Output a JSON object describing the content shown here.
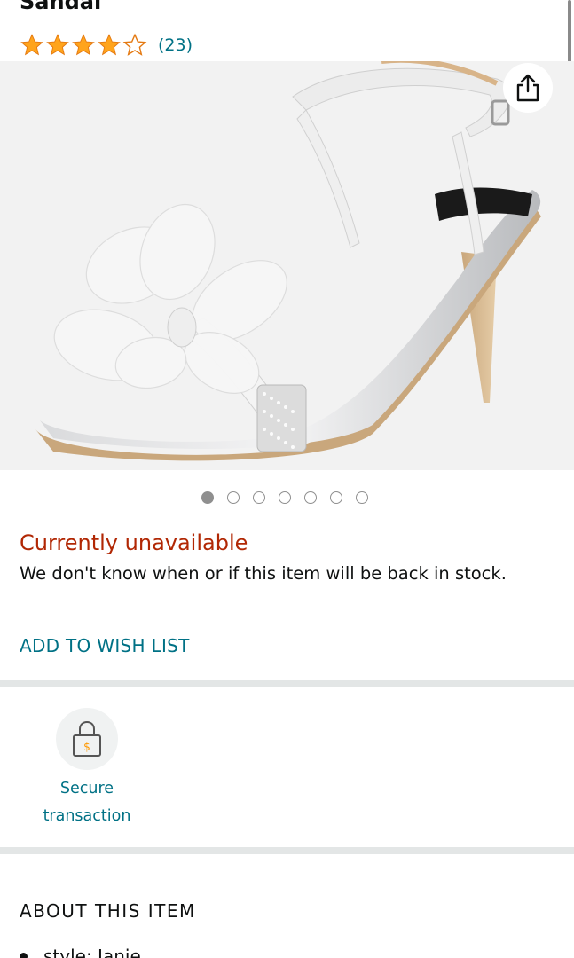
{
  "product": {
    "title": "Sandal",
    "rating": 4,
    "rating_count": "(23)"
  },
  "gallery": {
    "image": "white-satin-sandal-with-flower",
    "dot_count": 7,
    "active_index": 0
  },
  "availability": {
    "status": "Currently unavailable",
    "note": "We don't know when or if this item will be back in stock."
  },
  "actions": {
    "wish_list": "ADD TO WISH LIST",
    "share_icon": "share-icon"
  },
  "secure": {
    "icon": "padlock-dollar-icon",
    "line1": "Secure",
    "line2": "transaction"
  },
  "about": {
    "heading": "ABOUT THIS ITEM",
    "bullets": [
      "style: Janie"
    ]
  },
  "colors": {
    "star": "#ffa41c",
    "link": "#007185",
    "unavailable": "#b12704"
  }
}
